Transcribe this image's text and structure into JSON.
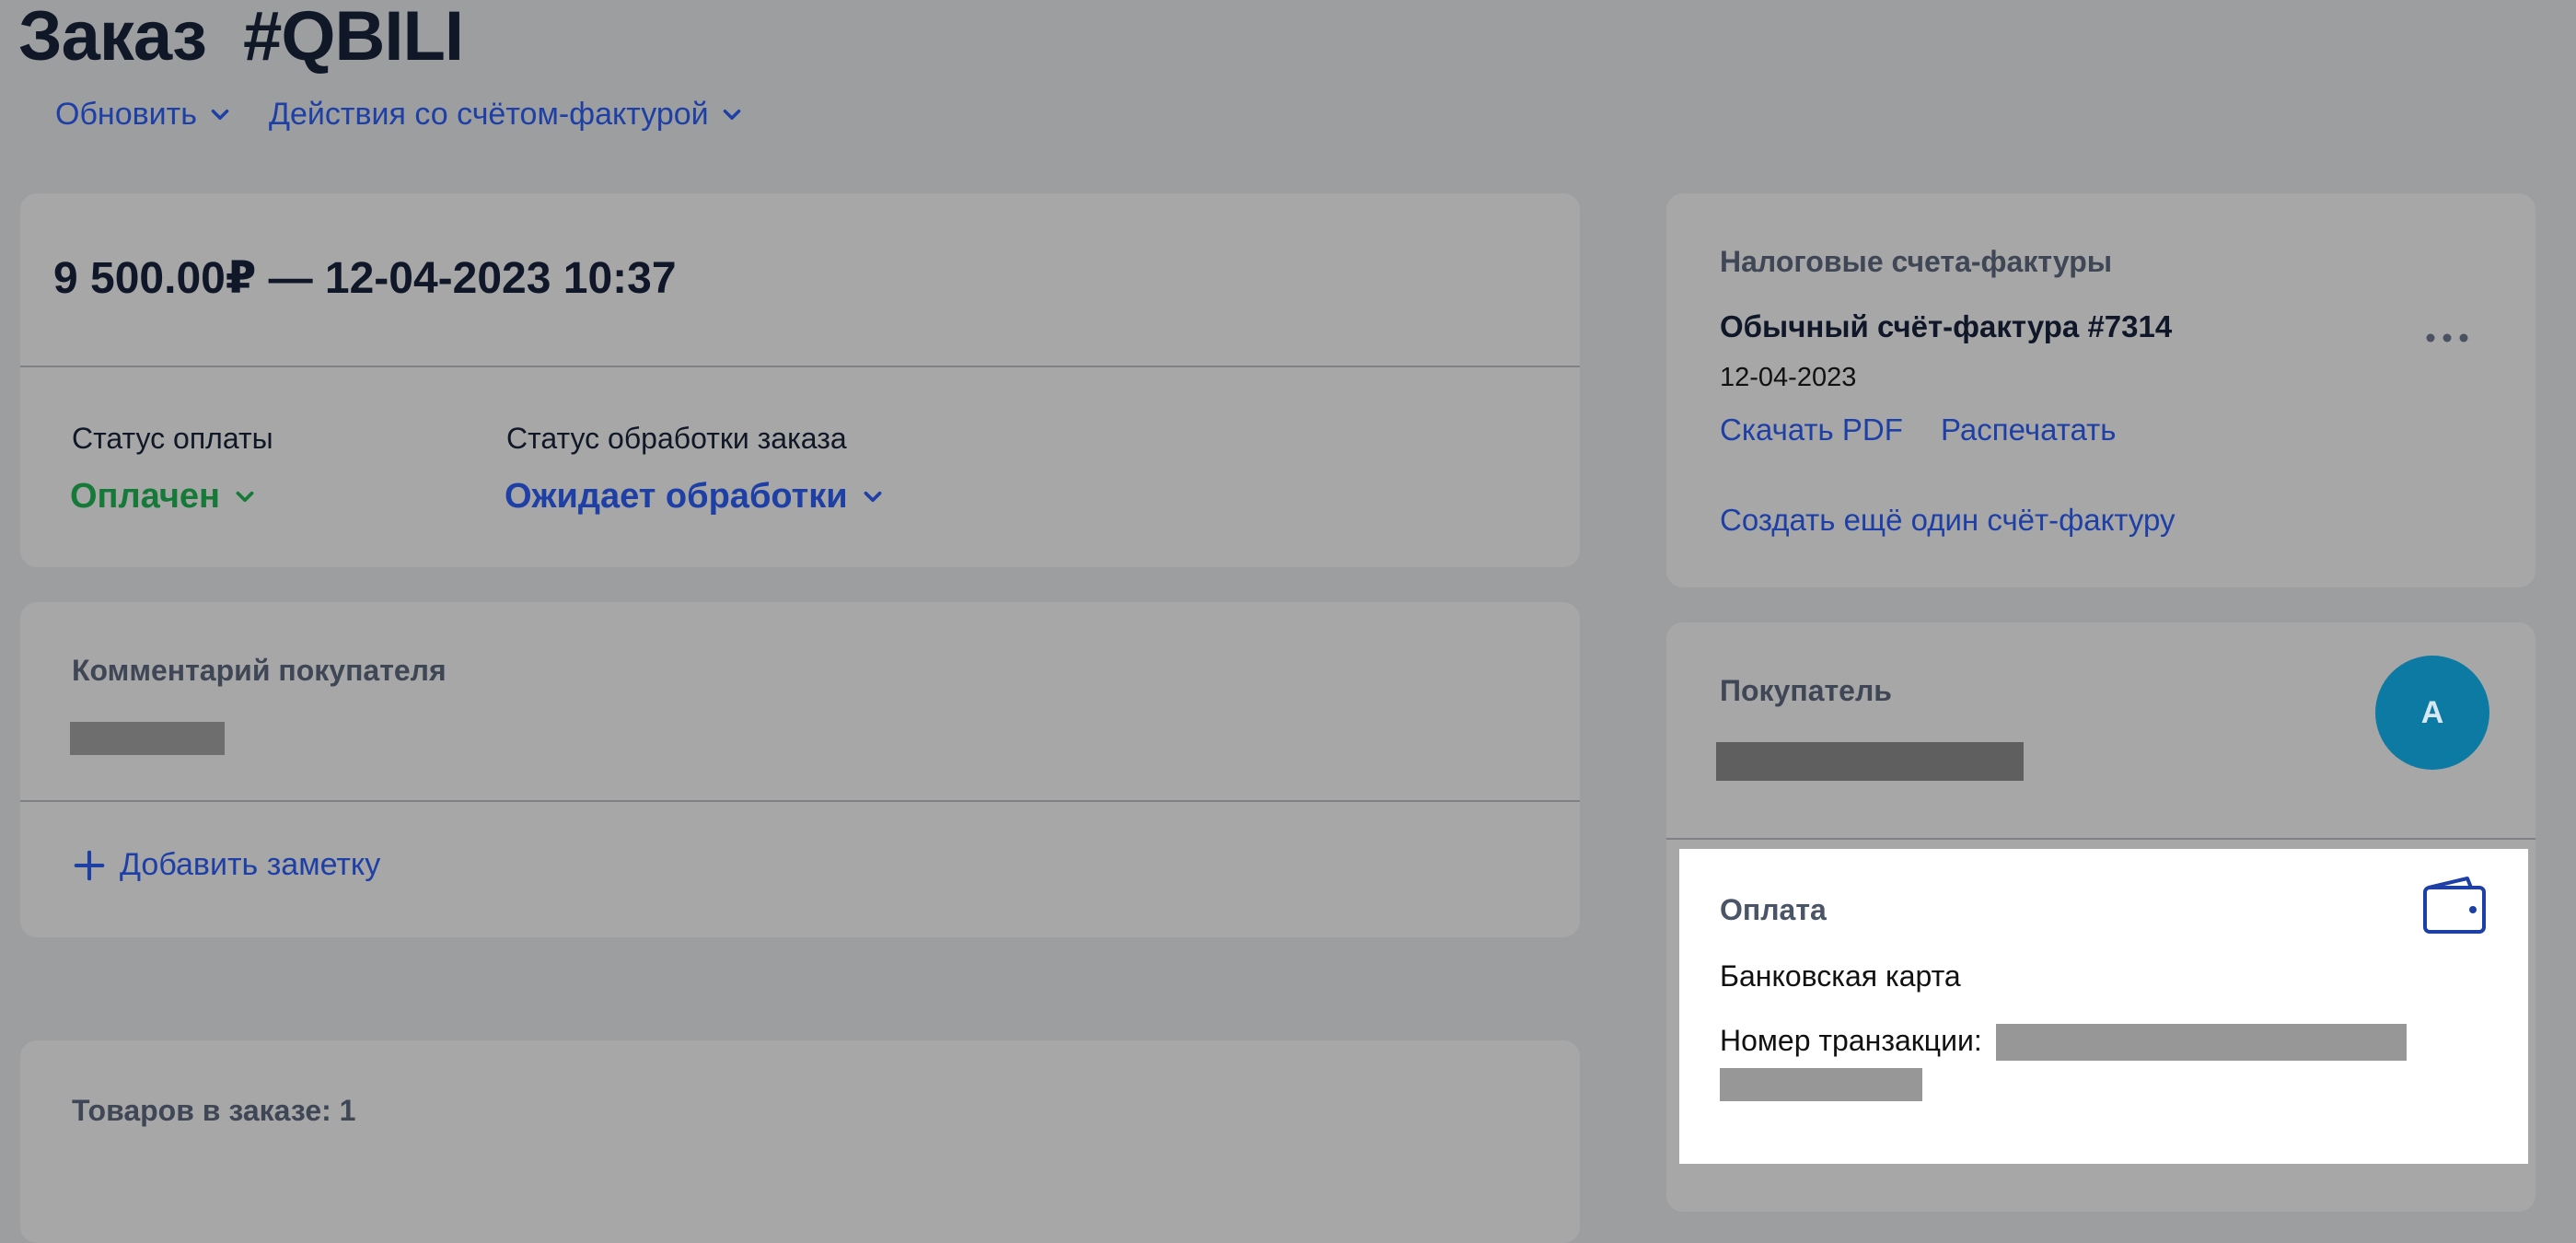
{
  "header": {
    "title": "Заказ  #QBILI",
    "actions": [
      {
        "label": "Обновить",
        "icon": "chevron-down-icon"
      },
      {
        "label": "Действия со счётом-фактурой",
        "icon": "chevron-down-icon"
      }
    ]
  },
  "order_summary": {
    "amount_line": "9 500.00₽ — 12-04-2023 10:37",
    "payment_status": {
      "label": "Статус оплаты",
      "value": "Оплачен"
    },
    "processing_status": {
      "label": "Статус обработки заказа",
      "value": "Ожидает обработки"
    }
  },
  "comment": {
    "heading": "Комментарий покупателя",
    "add_note_label": "Добавить заметку"
  },
  "items": {
    "count_label": "Товаров в заказе: 1"
  },
  "invoices": {
    "heading": "Налоговые счета-фактуры",
    "invoice_title": "Обычный счёт-фактура #7314",
    "invoice_date": "12-04-2023",
    "download_label": "Скачать PDF",
    "print_label": "Распечатать",
    "create_label": "Создать ещё один счёт-фактуру"
  },
  "customer": {
    "heading": "Покупатель",
    "avatar_initial": "A"
  },
  "payment": {
    "heading": "Оплата",
    "method": "Банковская карта",
    "transaction_label": "Номер транзакции:",
    "icon": "wallet-icon"
  },
  "colors": {
    "background": "#9c9ea0",
    "card": "#a7a7a7",
    "link": "#1d3fa6",
    "paid": "#157a37",
    "avatar": "#0c7aa3"
  }
}
